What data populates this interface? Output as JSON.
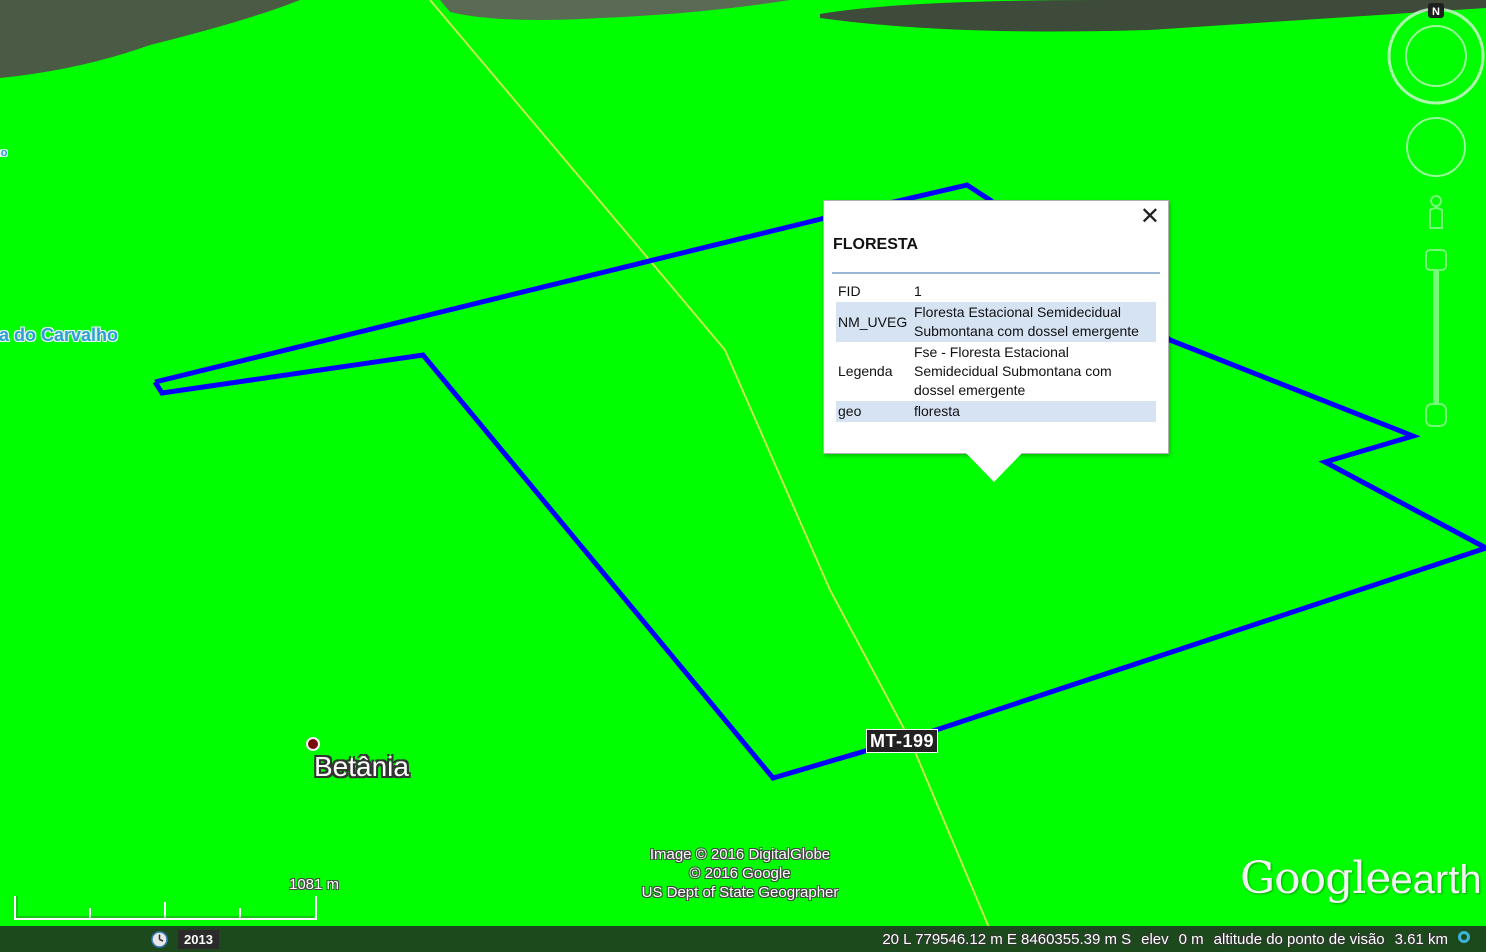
{
  "map": {
    "labels": {
      "edge_label": "ho",
      "carvalho": "ia do Carvalho",
      "betania": "Betânia",
      "road": "MT-199"
    }
  },
  "balloon": {
    "title": "FLORESTA",
    "close_icon": "close-icon",
    "rows": [
      {
        "key": "FID",
        "value": "1"
      },
      {
        "key": "NM_UVEG",
        "value": "Floresta Estacional Semidecidual Submontana com dossel emergente"
      },
      {
        "key": "Legenda",
        "value": "Fse - Floresta Estacional Semidecidual Submontana com dossel emergente"
      },
      {
        "key": "geo",
        "value": "floresta"
      }
    ]
  },
  "navigation": {
    "compass_label": "N",
    "icons": [
      "compass-ring-icon",
      "look-joystick-icon",
      "street-view-pegman-icon",
      "zoom-slider-icon"
    ]
  },
  "attribution": {
    "line1": "Image © 2016 DigitalGlobe",
    "line2": "© 2016 Google",
    "line3": "US Dept of State Geographer"
  },
  "logo": {
    "brand": "Google",
    "product": "earth"
  },
  "scale": {
    "label": "1081 m"
  },
  "status_bar": {
    "history_icon": "clock-history-icon",
    "year": "2013",
    "coords": "20 L 779546.12 m E 8460355.39 m S",
    "elev_label": "elev",
    "elev_value": "0 m",
    "eye_alt_label": "altitude do ponto de visão",
    "eye_alt_value": "3.61 km"
  },
  "colors": {
    "terrain": "#00ff00",
    "polygon_outline": "#0000ff",
    "road": "#e8e860",
    "table_stripe": "#d6e3f3"
  }
}
